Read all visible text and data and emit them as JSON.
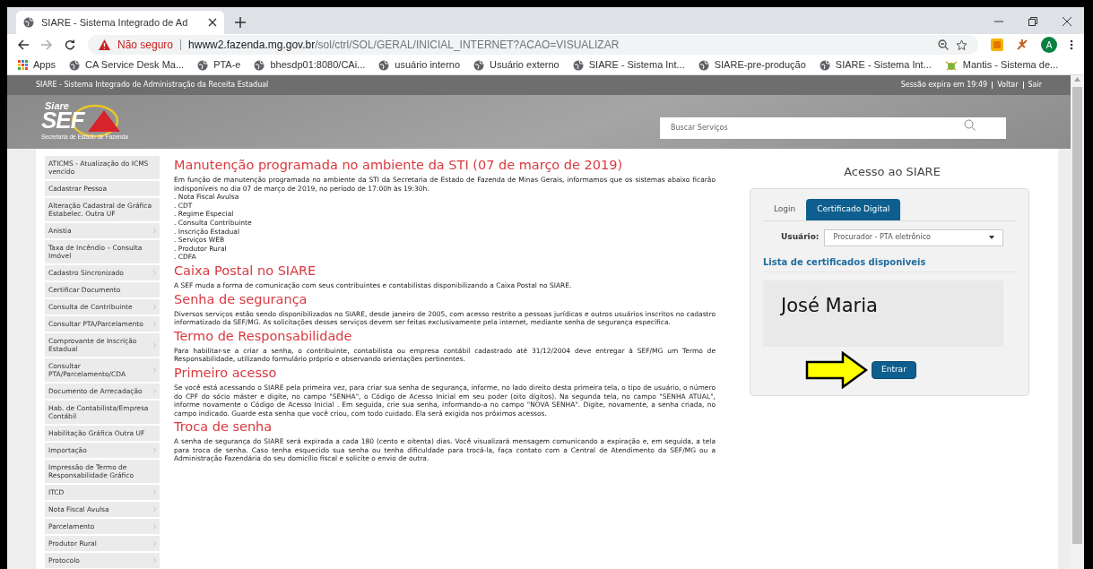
{
  "browser": {
    "tab_title": "SIARE - Sistema Integrado de Ad",
    "security_label": "Não seguro",
    "url_host": "hwww2.fazenda.mg.gov.br",
    "url_path": "/sol/ctrl/SOL/GERAL/INICIAL_INTERNET?ACAO=VISUALIZAR",
    "avatar": "A",
    "bookmarks": [
      {
        "kind": "apps",
        "label": "Apps"
      },
      {
        "kind": "globe",
        "label": "CA Service Desk Ma..."
      },
      {
        "kind": "globe",
        "label": "PTA-e"
      },
      {
        "kind": "globe",
        "label": "bhesdp01:8080/CAi..."
      },
      {
        "kind": "globe",
        "label": "usuário interno"
      },
      {
        "kind": "globe",
        "label": "Usuário externo"
      },
      {
        "kind": "globe",
        "label": "SIARE - Sistema Int..."
      },
      {
        "kind": "globe",
        "label": "SIARE-pre-produção"
      },
      {
        "kind": "globe",
        "label": "SIARE - Sistema Int..."
      },
      {
        "kind": "mantis",
        "label": "Mantis - Sistema de..."
      }
    ]
  },
  "header": {
    "title": "SIARE - Sistema Integrado de Administração da Receita Estadual",
    "session": "Sessão expira em 19:49",
    "links": [
      "Voltar",
      "Sair"
    ],
    "logo": {
      "top": "Siare",
      "main": "SEF",
      "caption": "Secretaria de Estado de Fazenda"
    },
    "search": {
      "placeholder": "Buscar Serviços"
    }
  },
  "sidebar": {
    "items": [
      {
        "label": "ATICMS - Atualização do ICMS vencido",
        "submenu": false
      },
      {
        "label": "Cadastrar Pessoa",
        "submenu": false
      },
      {
        "label": "Alteração Cadastral de Gráfica Estabelec. Outra UF",
        "submenu": false
      },
      {
        "label": "Anistia",
        "submenu": true
      },
      {
        "label": "Taxa de Incêndio – Consulta Imóvel",
        "submenu": false
      },
      {
        "label": "Cadastro Sincronizado",
        "submenu": true
      },
      {
        "label": "Certificar Documento",
        "submenu": false
      },
      {
        "label": "Consulta de Contribuinte",
        "submenu": true
      },
      {
        "label": "Consultar PTA/Parcelamento",
        "submenu": true
      },
      {
        "label": "Comprovante de Inscrição Estadual",
        "submenu": true
      },
      {
        "label": "Consultar PTA/Parcelamento/CDA",
        "submenu": true
      },
      {
        "label": "Documento de Arrecadação",
        "submenu": true
      },
      {
        "label": "Hab. de Contabilista/Empresa Contábil",
        "submenu": false
      },
      {
        "label": "Habilitação Gráfica Outra UF",
        "submenu": false
      },
      {
        "label": "Importação",
        "submenu": true
      },
      {
        "label": "Impressão de Termo de Responsabilidade Gráfico",
        "submenu": false
      },
      {
        "label": "ITCD",
        "submenu": true
      },
      {
        "label": "Nota Fiscal Avulsa",
        "submenu": true
      },
      {
        "label": "Parcelamento",
        "submenu": true
      },
      {
        "label": "Produtor Rural",
        "submenu": true
      },
      {
        "label": "Protocolo",
        "submenu": true
      }
    ]
  },
  "sections": [
    {
      "heading": "Manutenção programada no ambiente da STI (07 de março de 2019)",
      "lines": [
        {
          "kind": "paragraph",
          "text": "Em função de manutenção programada no ambiente da STI da Secretaria de Estado de Fazenda de Minas Gerais, informamos que os sistemas abaixo ficarão indisponíveis no dia 07 de março de 2019, no período de 17:00h às 19:30h."
        },
        {
          "kind": "list_item",
          "text": ". Nota Fiscal Avulsa"
        },
        {
          "kind": "list_item",
          "text": ". CDT"
        },
        {
          "kind": "list_item",
          "text": ". Regime Especial"
        },
        {
          "kind": "list_item",
          "text": ". Consulta Contribuinte"
        },
        {
          "kind": "list_item",
          "text": ". Inscrição Estadual"
        },
        {
          "kind": "list_item",
          "text": ". Serviços WEB"
        },
        {
          "kind": "list_item",
          "text": ". Produtor Rural"
        },
        {
          "kind": "list_item",
          "text": ". CDFA"
        }
      ]
    },
    {
      "heading": "Caixa Postal no SIARE",
      "lines": [
        {
          "kind": "paragraph",
          "text": "A SEF muda a forma de comunicação com seus contribuintes e contabilistas disponibilizando a Caixa Postal no SIARE."
        }
      ]
    },
    {
      "heading": "Senha de segurança",
      "lines": [
        {
          "kind": "paragraph",
          "text": "Diversos serviços estão sendo disponibilizados no SIARE, desde janeiro de 2005, com acesso restrito a pessoas jurídicas e outros usuários inscritos no cadastro informatizado da SEF/MG. As solicitações desses serviços devem ser feitas exclusivamente pela internet, mediante senha de segurança específica."
        }
      ]
    },
    {
      "heading": "Termo de Responsabilidade",
      "lines": [
        {
          "kind": "paragraph",
          "text": "Para habilitar-se a criar a senha, o contribuinte, contabilista ou empresa contábil cadastrado até 31/12/2004 deve entregar à SEF/MG um Termo de Responsabilidade, utilizando formulário próprio e observando orientações pertinentes."
        }
      ]
    },
    {
      "heading": "Primeiro acesso",
      "lines": [
        {
          "kind": "paragraph",
          "text": "Se você está acessando o SIARE pela primeira vez, para criar sua senha de segurança, informe, no lado direito desta primeira tela, o tipo de usuário, o número do CPF do sócio máster e digite, no campo \"SENHA\", o Código de Acesso Inicial em seu poder (oito dígitos). Na segunda tela, no campo \"SENHA ATUAL\", informe novamente o Código de Acesso Inicial . Em seguida, crie sua senha, informando-a no campo \"NOVA SENHA\". Digite, novamente, a senha criada, no campo indicado. Guarde esta senha que você criou, com todo cuidado. Ela será exigida nos próximos acessos."
        }
      ]
    },
    {
      "heading": "Troca de senha",
      "lines": [
        {
          "kind": "paragraph",
          "text": "A senha de segurança do SIARE será expirada a cada 180 (cento e oitenta) dias. Você visualizará mensagem comunicando a expiração e, em seguida, a tela para troca de senha. Caso tenha esquecido sua senha ou tenha dificuldade para trocá-la, faça contato com a Central de Atendimento da SEF/MG ou a Administração Fazendária do seu domicílio fiscal e solicite o envio de outra."
        }
      ]
    }
  ],
  "login": {
    "title": "Acesso ao SIARE",
    "tabs": [
      {
        "label": "Login",
        "selected": false
      },
      {
        "label": "Certificado Digital",
        "selected": true
      }
    ],
    "user_label": "Usuário:",
    "user_value": "Procurador - PTA eletrônico",
    "list_heading": "Lista de certificados disponiveis",
    "certificates": [
      "José Maria"
    ],
    "button": "Entrar"
  }
}
